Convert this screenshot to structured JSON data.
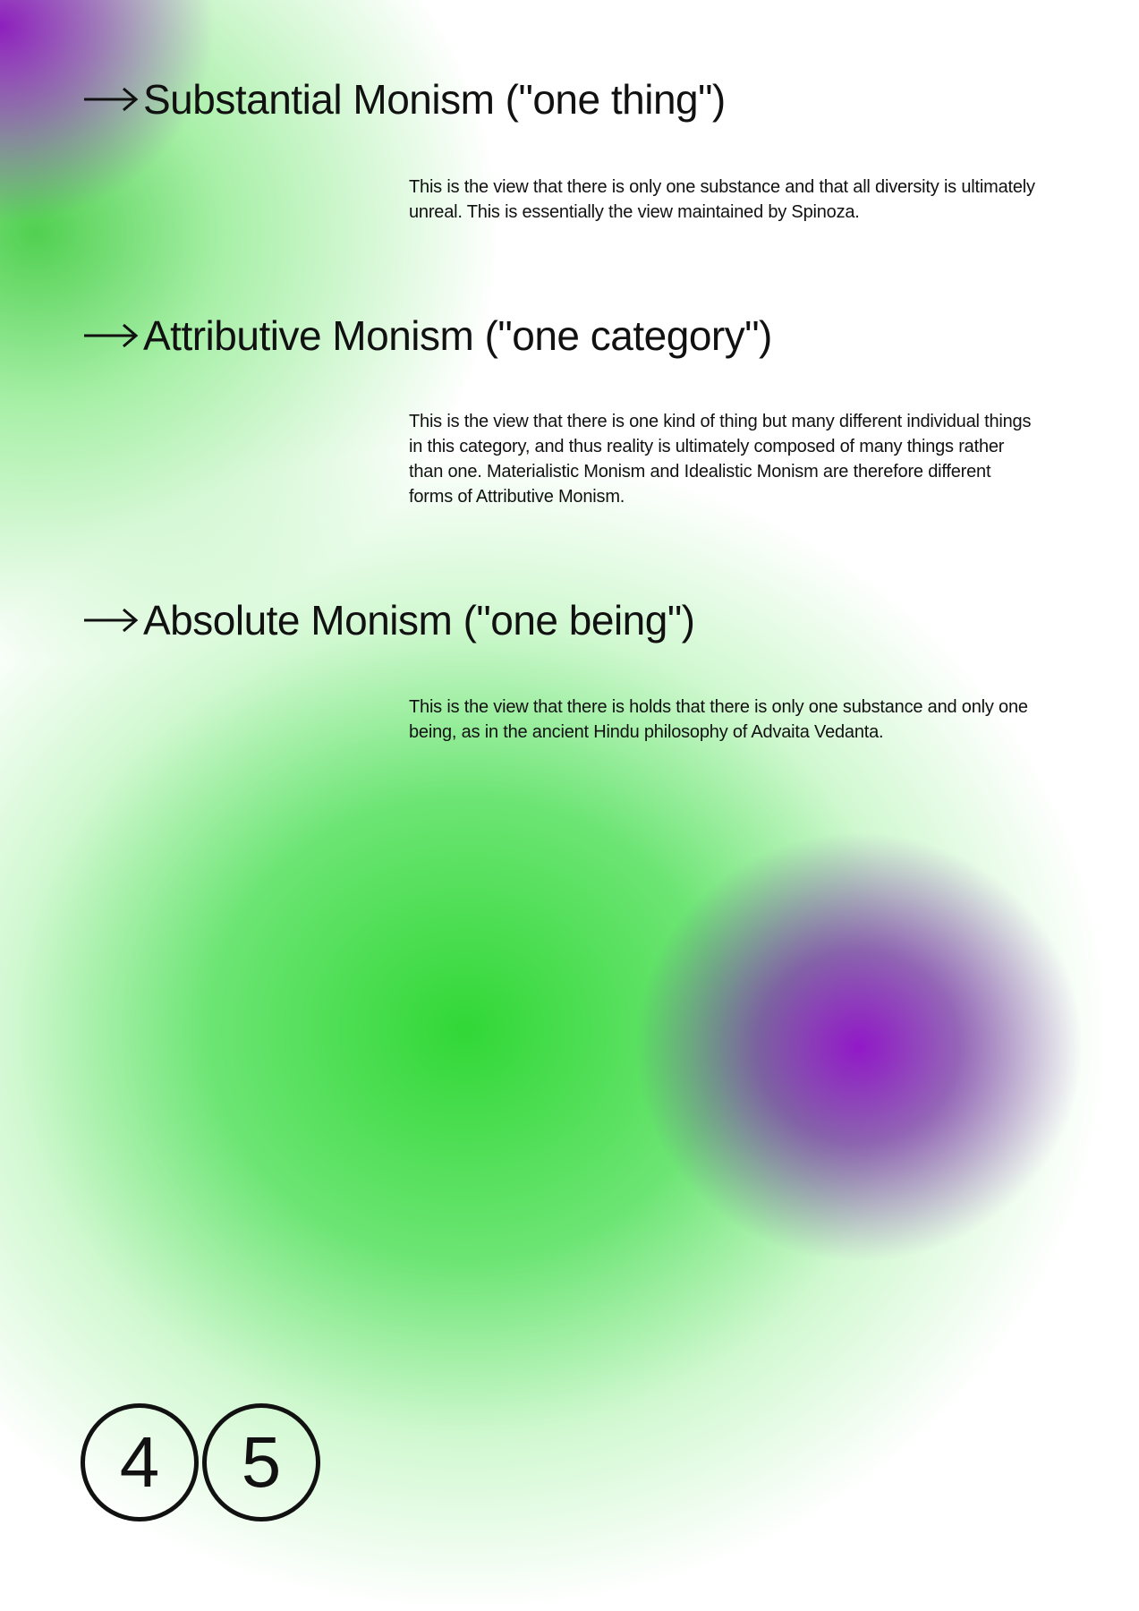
{
  "sections": [
    {
      "title": "Substantial Monism (\"one thing\")",
      "body": "This is the view that there is only one substance and that all diversity is ultimately unreal. This is essentially the view maintained by Spinoza."
    },
    {
      "title": "Attributive Monism (\"one category\")",
      "body": "This is the view that there is one kind of thing but many different individual things in this category, and thus reality is ultimately composed of many things rather than one. Materialistic Monism and Idealistic Monism are therefore different forms of Attributive Monism."
    },
    {
      "title": "Absolute Monism (\"one being\")",
      "body": "This is the view that there is holds that there is only one substance and only one being, as in the ancient Hindu philosophy of Advaita Vedanta."
    }
  ],
  "pages": {
    "left": "4",
    "right": "5"
  },
  "colors": {
    "text": "#111111",
    "green": "#3cdc46",
    "purple": "#8c14be",
    "background": "#ffffff"
  },
  "icons": {
    "heading_marker": "arrow-right-icon"
  }
}
